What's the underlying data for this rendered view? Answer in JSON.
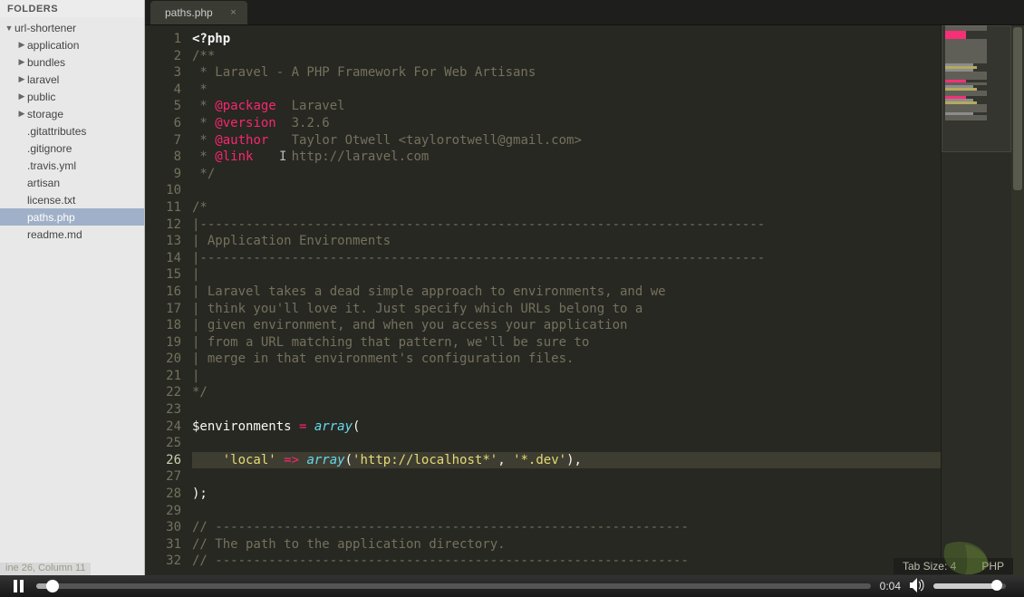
{
  "sidebar": {
    "header": "FOLDERS",
    "tree": [
      {
        "label": "url-shortener",
        "depth": 0,
        "arrow": "down",
        "folder": true,
        "sel": false
      },
      {
        "label": "application",
        "depth": 1,
        "arrow": "right",
        "folder": true,
        "sel": false
      },
      {
        "label": "bundles",
        "depth": 1,
        "arrow": "right",
        "folder": true,
        "sel": false
      },
      {
        "label": "laravel",
        "depth": 1,
        "arrow": "right",
        "folder": true,
        "sel": false
      },
      {
        "label": "public",
        "depth": 1,
        "arrow": "right",
        "folder": true,
        "sel": false
      },
      {
        "label": "storage",
        "depth": 1,
        "arrow": "right",
        "folder": true,
        "sel": false
      },
      {
        "label": ".gitattributes",
        "depth": 1,
        "arrow": "",
        "folder": false,
        "sel": false
      },
      {
        "label": ".gitignore",
        "depth": 1,
        "arrow": "",
        "folder": false,
        "sel": false
      },
      {
        "label": ".travis.yml",
        "depth": 1,
        "arrow": "",
        "folder": false,
        "sel": false
      },
      {
        "label": "artisan",
        "depth": 1,
        "arrow": "",
        "folder": false,
        "sel": false
      },
      {
        "label": "license.txt",
        "depth": 1,
        "arrow": "",
        "folder": false,
        "sel": false
      },
      {
        "label": "paths.php",
        "depth": 1,
        "arrow": "",
        "folder": false,
        "sel": true
      },
      {
        "label": "readme.md",
        "depth": 1,
        "arrow": "",
        "folder": false,
        "sel": false
      }
    ]
  },
  "tabs": [
    {
      "label": "paths.php",
      "active": true
    }
  ],
  "editor": {
    "current_line": 26,
    "lines": [
      {
        "n": 1,
        "t": "openphp",
        "text": "<?php"
      },
      {
        "n": 2,
        "t": "cmt",
        "text": "/**"
      },
      {
        "n": 3,
        "t": "cmt",
        "text": " * Laravel - A PHP Framework For Web Artisans"
      },
      {
        "n": 4,
        "t": "cmt",
        "text": " *"
      },
      {
        "n": 5,
        "t": "docline",
        "pre": " * ",
        "tag": "@package",
        "post": "  Laravel"
      },
      {
        "n": 6,
        "t": "docline",
        "pre": " * ",
        "tag": "@version",
        "post": "  3.2.6"
      },
      {
        "n": 7,
        "t": "docline",
        "pre": " * ",
        "tag": "@author",
        "post": "   Taylor Otwell <taylorotwell@gmail.com>"
      },
      {
        "n": 8,
        "t": "docline",
        "pre": " * ",
        "tag": "@link",
        "post": "     http://laravel.com"
      },
      {
        "n": 9,
        "t": "cmt",
        "text": " */"
      },
      {
        "n": 10,
        "t": "blank",
        "text": ""
      },
      {
        "n": 11,
        "t": "cmt",
        "text": "/*"
      },
      {
        "n": 12,
        "t": "cmt",
        "text": "|--------------------------------------------------------------------------"
      },
      {
        "n": 13,
        "t": "cmt",
        "text": "| Application Environments"
      },
      {
        "n": 14,
        "t": "cmt",
        "text": "|--------------------------------------------------------------------------"
      },
      {
        "n": 15,
        "t": "cmt",
        "text": "|"
      },
      {
        "n": 16,
        "t": "cmt",
        "text": "| Laravel takes a dead simple approach to environments, and we"
      },
      {
        "n": 17,
        "t": "cmt",
        "text": "| think you'll love it. Just specify which URLs belong to a"
      },
      {
        "n": 18,
        "t": "cmt",
        "text": "| given environment, and when you access your application"
      },
      {
        "n": 19,
        "t": "cmt",
        "text": "| from a URL matching that pattern, we'll be sure to"
      },
      {
        "n": 20,
        "t": "cmt",
        "text": "| merge in that environment's configuration files."
      },
      {
        "n": 21,
        "t": "cmt",
        "text": "|"
      },
      {
        "n": 22,
        "t": "cmt",
        "text": "*/"
      },
      {
        "n": 23,
        "t": "blank",
        "text": ""
      },
      {
        "n": 24,
        "t": "assign",
        "var": "$environments",
        "fn": "array",
        "text": "("
      },
      {
        "n": 25,
        "t": "blank",
        "text": ""
      },
      {
        "n": 26,
        "t": "arrline",
        "indent": "    ",
        "key": "'local'",
        "fn": "array",
        "args": "('http://localhost*', '*.dev'),"
      },
      {
        "n": 27,
        "t": "blank",
        "text": ""
      },
      {
        "n": 28,
        "t": "plainpunc",
        "text": ");"
      },
      {
        "n": 29,
        "t": "blank",
        "text": ""
      },
      {
        "n": 30,
        "t": "cmt",
        "text": "// --------------------------------------------------------------"
      },
      {
        "n": 31,
        "t": "cmt",
        "text": "// The path to the application directory."
      },
      {
        "n": 32,
        "t": "cmt",
        "text": "// --------------------------------------------------------------"
      }
    ]
  },
  "status": {
    "left": "ine 26, Column 11",
    "tab_size": "Tab Size: 4",
    "lang": "PHP"
  },
  "player": {
    "time": "0:04",
    "seek_pct": 2,
    "vol_pct": 88,
    "state": "playing"
  }
}
